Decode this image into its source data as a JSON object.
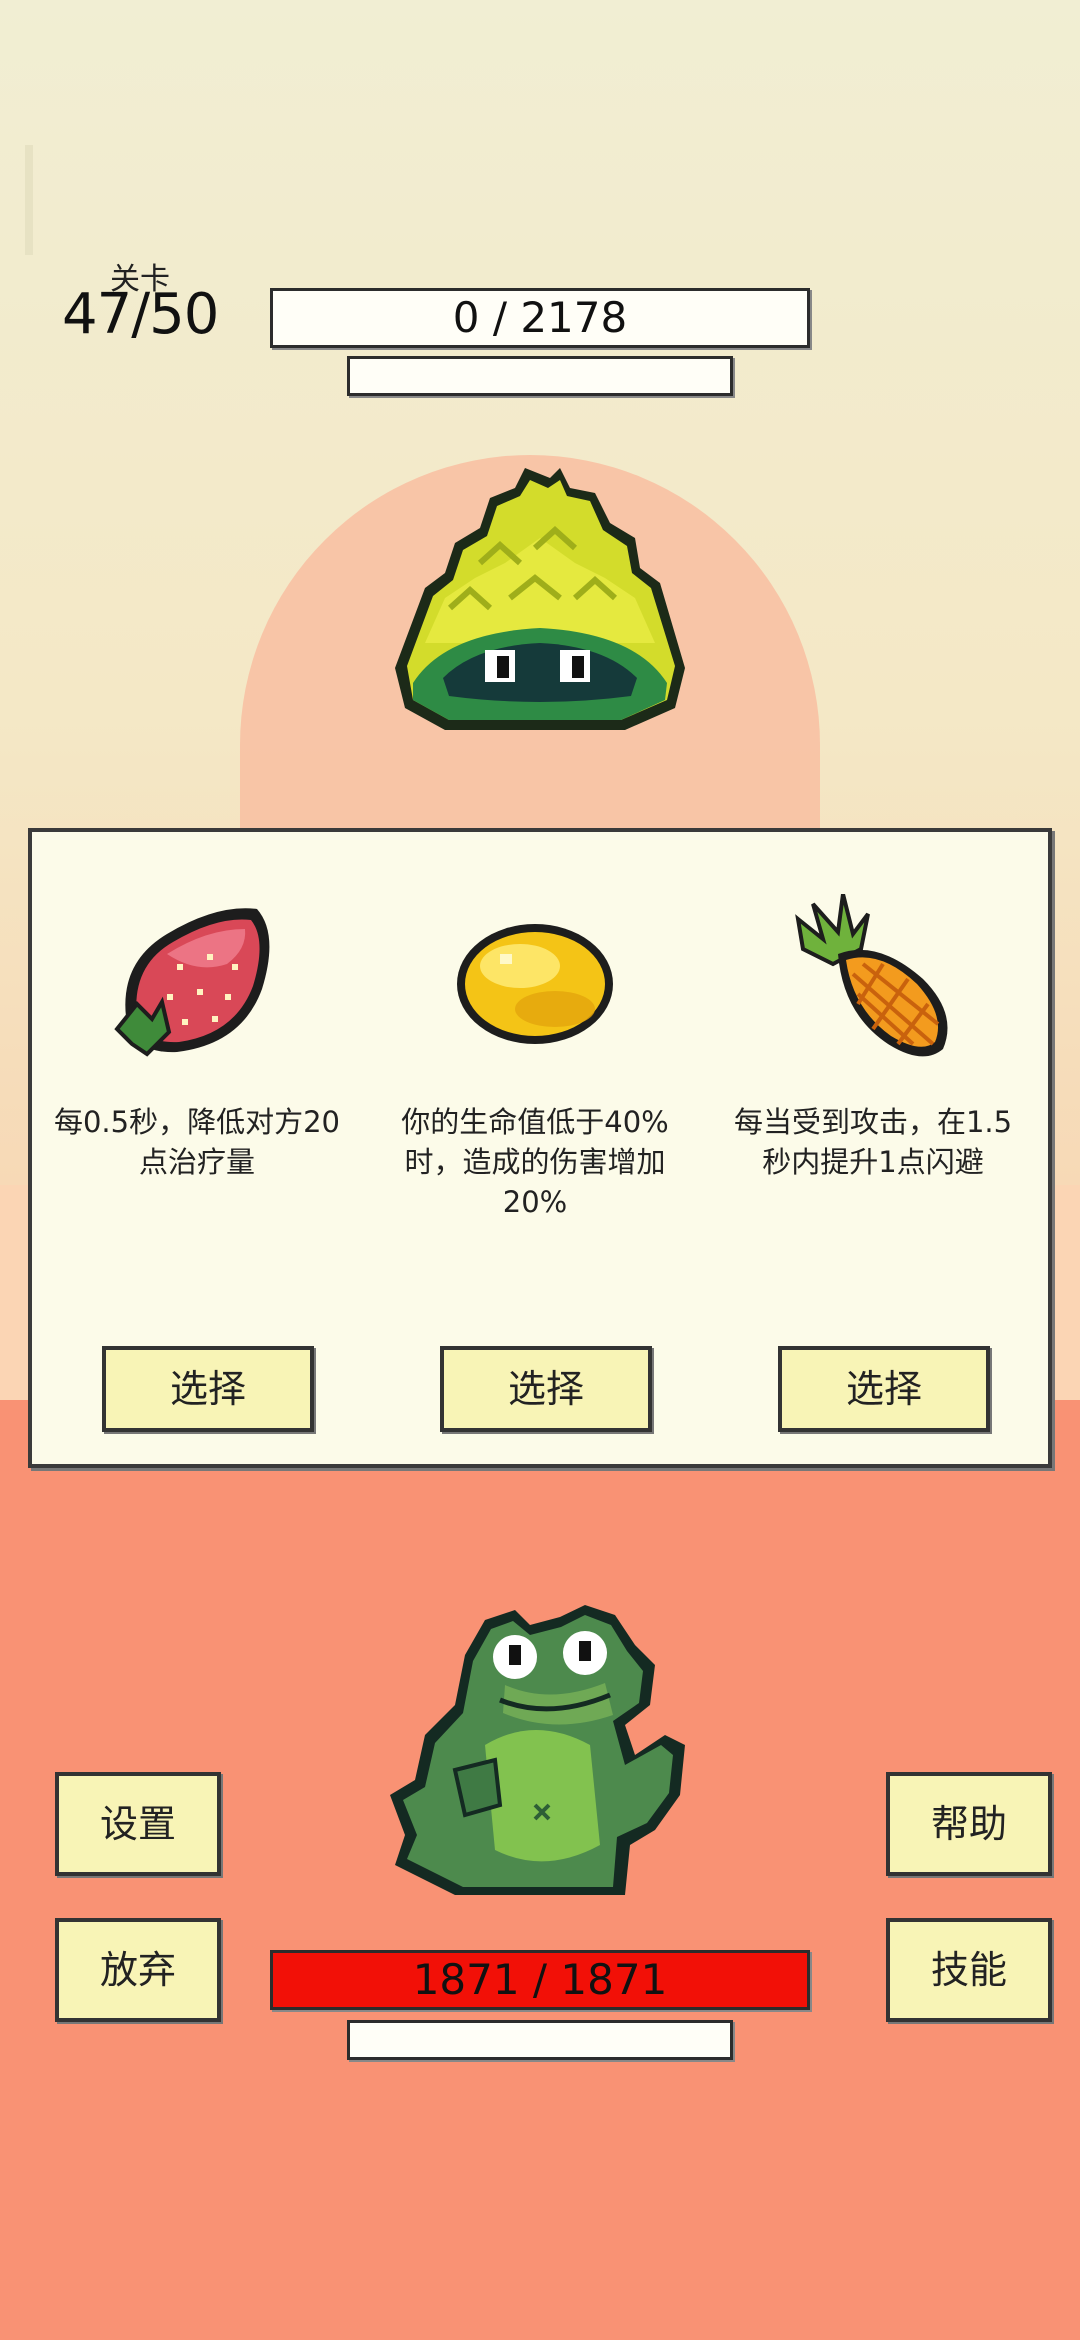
{
  "hud": {
    "level_label": "关卡",
    "level_value": "47/50",
    "enemy_hp_text": "0 / 2178",
    "player_hp_text": "1871 / 1871"
  },
  "choices": [
    {
      "icon": "strawberry-icon",
      "desc": "每0.5秒，降低对方20点治疗量",
      "button": "选择"
    },
    {
      "icon": "lemon-icon",
      "desc": "你的生命值低于40%时，造成的伤害增加20%",
      "button": "选择"
    },
    {
      "icon": "pineapple-icon",
      "desc": "每当受到攻击，在1.5秒内提升1点闪避",
      "button": "选择"
    }
  ],
  "buttons": {
    "settings": "设置",
    "give_up": "放弃",
    "help": "帮助",
    "skills": "技能"
  },
  "colors": {
    "player_hp_bar": "#f21007",
    "button_fill": "#f8f4b6",
    "bottom_background": "#f99274",
    "top_background": "#efeccf"
  }
}
